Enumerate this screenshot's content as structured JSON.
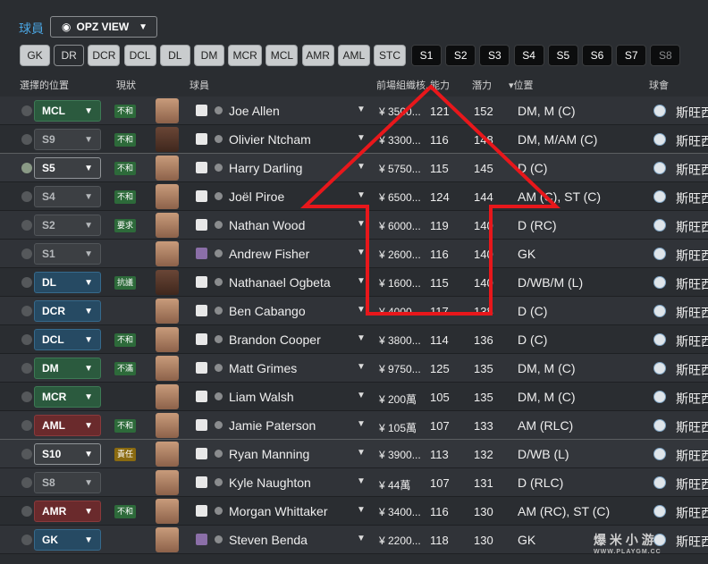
{
  "topbar": {
    "squad_label": "球員",
    "view_label": "OPZ VIEW"
  },
  "position_buttons": [
    {
      "label": "GK",
      "style": "light"
    },
    {
      "label": "DR",
      "style": "sel"
    },
    {
      "label": "DCR",
      "style": "light"
    },
    {
      "label": "DCL",
      "style": "light"
    },
    {
      "label": "DL",
      "style": "light"
    },
    {
      "label": "DM",
      "style": "light"
    },
    {
      "label": "MCR",
      "style": "light"
    },
    {
      "label": "MCL",
      "style": "light"
    },
    {
      "label": "AMR",
      "style": "light"
    },
    {
      "label": "AML",
      "style": "light"
    },
    {
      "label": "STC",
      "style": "light"
    },
    {
      "label": "S1",
      "style": "dark"
    },
    {
      "label": "S2",
      "style": "dark"
    },
    {
      "label": "S3",
      "style": "dark"
    },
    {
      "label": "S4",
      "style": "dark"
    },
    {
      "label": "S5",
      "style": "dark"
    },
    {
      "label": "S6",
      "style": "dark"
    },
    {
      "label": "S7",
      "style": "dark"
    },
    {
      "label": "S8",
      "style": "dim"
    }
  ],
  "columns": {
    "selected_position": "選擇的位置",
    "status": "現狀",
    "player": "球員",
    "wage": "前場組織核...",
    "ca": "能力",
    "pa": "潛力",
    "position": "▾位置",
    "club": "球會"
  },
  "players": [
    {
      "pos": "MCL",
      "pos_color": "green",
      "status": "不和",
      "status_color": "green",
      "name": "Joe Allen",
      "wage": "¥ 3500...",
      "ca": "121",
      "pa": "152",
      "position": "DM, M (C)",
      "club": "斯旺西",
      "face": "light",
      "gk": false,
      "check": false,
      "row": "alt"
    },
    {
      "pos": "S9",
      "pos_color": "grey",
      "status": "不和",
      "status_color": "green",
      "name": "Olivier Ntcham",
      "wage": "¥ 3300...",
      "ca": "116",
      "pa": "148",
      "position": "DM, M/AM (C)",
      "club": "斯旺西",
      "face": "dark",
      "gk": false,
      "check": false,
      "row": "norm"
    },
    {
      "pos": "S5",
      "pos_color": "sel",
      "status": "不和",
      "status_color": "green",
      "name": "Harry Darling",
      "wage": "¥ 5750...",
      "ca": "115",
      "pa": "145",
      "position": "D (C)",
      "club": "斯旺西",
      "face": "light",
      "gk": false,
      "check": true,
      "row": "hl"
    },
    {
      "pos": "S4",
      "pos_color": "grey",
      "status": "不和",
      "status_color": "green",
      "name": "Joël Piroe",
      "wage": "¥ 6500...",
      "ca": "124",
      "pa": "144",
      "position": "AM (C), ST (C)",
      "club": "斯旺西",
      "face": "light",
      "gk": false,
      "check": false,
      "row": "norm"
    },
    {
      "pos": "S2",
      "pos_color": "grey",
      "status": "要求",
      "status_color": "green",
      "name": "Nathan Wood",
      "wage": "¥ 6000...",
      "ca": "119",
      "pa": "140",
      "position": "D (RC)",
      "club": "斯旺西",
      "face": "light",
      "gk": false,
      "check": false,
      "row": "alt"
    },
    {
      "pos": "S1",
      "pos_color": "grey",
      "status": "",
      "status_color": "green",
      "name": "Andrew Fisher",
      "wage": "¥ 2600...",
      "ca": "116",
      "pa": "140",
      "position": "GK",
      "club": "斯旺西",
      "face": "light",
      "gk": true,
      "check": false,
      "row": "alt"
    },
    {
      "pos": "DL",
      "pos_color": "blue",
      "status": "抗議",
      "status_color": "green",
      "name": "Nathanael Ogbeta",
      "wage": "¥ 1600...",
      "ca": "115",
      "pa": "140",
      "position": "D/WB/M (L)",
      "club": "斯旺西",
      "face": "dark",
      "gk": false,
      "check": false,
      "row": "norm"
    },
    {
      "pos": "DCR",
      "pos_color": "blue",
      "status": "",
      "status_color": "green",
      "name": "Ben Cabango",
      "wage": "¥ 4000...",
      "ca": "117",
      "pa": "138",
      "position": "D (C)",
      "club": "斯旺西",
      "face": "light",
      "gk": false,
      "check": false,
      "row": "alt"
    },
    {
      "pos": "DCL",
      "pos_color": "blue",
      "status": "不和",
      "status_color": "green",
      "name": "Brandon Cooper",
      "wage": "¥ 3800...",
      "ca": "114",
      "pa": "136",
      "position": "D (C)",
      "club": "斯旺西",
      "face": "light",
      "gk": false,
      "check": false,
      "row": "norm"
    },
    {
      "pos": "DM",
      "pos_color": "green",
      "status": "不滿",
      "status_color": "green",
      "name": "Matt Grimes",
      "wage": "¥ 9750...",
      "ca": "125",
      "pa": "135",
      "position": "DM, M (C)",
      "club": "斯旺西",
      "face": "light",
      "gk": false,
      "check": false,
      "row": "alt"
    },
    {
      "pos": "MCR",
      "pos_color": "green",
      "status": "",
      "status_color": "green",
      "name": "Liam Walsh",
      "wage": "¥ 200萬",
      "ca": "105",
      "pa": "135",
      "position": "DM, M (C)",
      "club": "斯旺西",
      "face": "light",
      "gk": false,
      "check": false,
      "row": "norm"
    },
    {
      "pos": "AML",
      "pos_color": "red",
      "status": "不和",
      "status_color": "green",
      "name": "Jamie Paterson",
      "wage": "¥ 105萬",
      "ca": "107",
      "pa": "133",
      "position": "AM (RLC)",
      "club": "斯旺西",
      "face": "light",
      "gk": false,
      "check": false,
      "row": "alt"
    },
    {
      "pos": "S10",
      "pos_color": "sel",
      "status": "責任",
      "status_color": "amber",
      "name": "Ryan Manning",
      "wage": "¥ 3900...",
      "ca": "113",
      "pa": "132",
      "position": "D/WB (L)",
      "club": "斯旺西",
      "face": "light",
      "gk": false,
      "check": false,
      "row": "hl"
    },
    {
      "pos": "S8",
      "pos_color": "grey",
      "status": "",
      "status_color": "green",
      "name": "Kyle Naughton",
      "wage": "¥ 44萬",
      "ca": "107",
      "pa": "131",
      "position": "D (RLC)",
      "club": "斯旺西",
      "face": "light",
      "gk": false,
      "check": false,
      "row": "alt"
    },
    {
      "pos": "AMR",
      "pos_color": "red",
      "status": "不和",
      "status_color": "green",
      "name": "Morgan Whittaker",
      "wage": "¥ 3400...",
      "ca": "116",
      "pa": "130",
      "position": "AM (RC), ST (C)",
      "club": "斯旺西",
      "face": "light",
      "gk": false,
      "check": false,
      "row": "norm"
    },
    {
      "pos": "GK",
      "pos_color": "blue",
      "status": "",
      "status_color": "green",
      "name": "Steven Benda",
      "wage": "¥ 2200...",
      "ca": "118",
      "pa": "130",
      "position": "GK",
      "club": "斯旺西",
      "face": "light",
      "gk": true,
      "check": false,
      "row": "alt"
    }
  ],
  "watermark": {
    "text": "爆 米 小 游",
    "sub": "WWW.PLAYGM.CC"
  }
}
